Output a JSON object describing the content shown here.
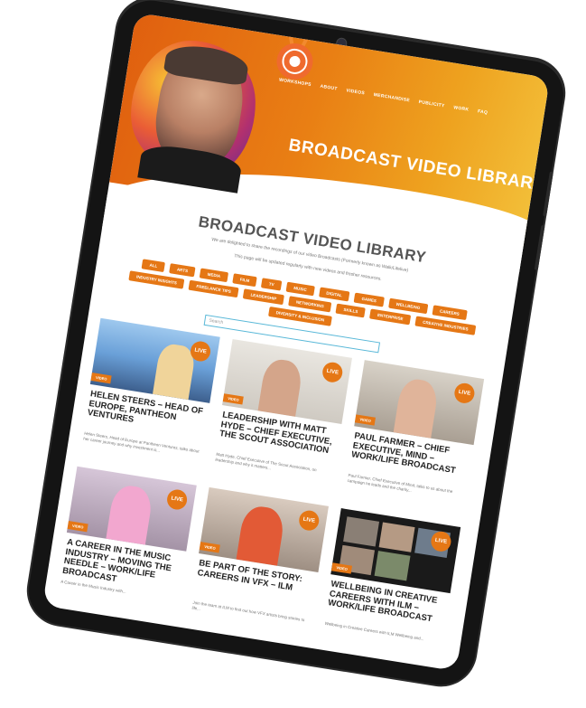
{
  "nav": [
    "WORKSHOPS",
    "ABOUT",
    "VIDEOS",
    "MERCHANDISE",
    "PUBLICITY",
    "WORK",
    "FAQ"
  ],
  "hero_title": "BROADCAST VIDEO LIBRARY",
  "heading": "BROADCAST VIDEO LIBRARY",
  "intro_line1": "We are delighted to share the recordings of our video Broadcasts (Formerly known as Walk/Lifelive)",
  "intro_line2": "This page will be updated regularly with new videos and fresher resources.",
  "filters": [
    "ALL",
    "ARTS",
    "MEDIA",
    "FILM",
    "TV",
    "MUSIC",
    "DIGITAL",
    "GAMES",
    "WELLBEING",
    "CAREERS",
    "INDUSTRY INSIGHTS",
    "FREELANCE TIPS",
    "LEADERSHIP",
    "NETWORKING",
    "SKILLS",
    "ENTERPRISE",
    "CREATIVE INDUSTRIES",
    "DIVERSITY & INCLUSION"
  ],
  "search_placeholder": "Search",
  "cards": [
    {
      "title": "HELEN STEERS – HEAD OF EUROPE, PANTHEON VENTURES",
      "desc": "Helen Steers, Head of Europe at Pantheon Ventures, talks about her career journey and why investment is...",
      "badge": "LIVE",
      "ribbon": "VIDEO"
    },
    {
      "title": "LEADERSHIP WITH MATT HYDE – CHIEF EXECUTIVE, THE SCOUT ASSOCIATION",
      "desc": "Matt Hyde, Chief Executive of The Scout Association, on leadership and why it matters...",
      "badge": "LIVE",
      "ribbon": "VIDEO"
    },
    {
      "title": "PAUL FARMER – CHIEF EXECUTIVE, MIND – WORK/LIFE BROADCAST",
      "desc": "Paul Farmer, Chief Executive of Mind, talks to us about the campaign he leads and the charity...",
      "badge": "LIVE",
      "ribbon": "VIDEO"
    },
    {
      "title": "A CAREER IN THE MUSIC INDUSTRY – MOVING THE NEEDLE – WORK/LIFE BROADCAST",
      "desc": "A Career in the Music Industry with...",
      "badge": "LIVE",
      "ribbon": "VIDEO"
    },
    {
      "title": "BE PART OF THE STORY: CAREERS IN VFX – ILM",
      "desc": "Join the team at ILM to find out how VFX artists bring stories to life...",
      "badge": "LIVE",
      "ribbon": "VIDEO"
    },
    {
      "title": "WELLBEING IN CREATIVE CAREERS WITH ILM – WORK/LIFE BROADCAST",
      "desc": "Wellbeing in Creative Careers with ILM Wellbeing and...",
      "badge": "LIVE",
      "ribbon": "VIDEO"
    }
  ],
  "colors": {
    "accent": "#e57715",
    "hero_start": "#e0600f",
    "hero_end": "#f3c03a",
    "search_border": "#59b8d8"
  }
}
